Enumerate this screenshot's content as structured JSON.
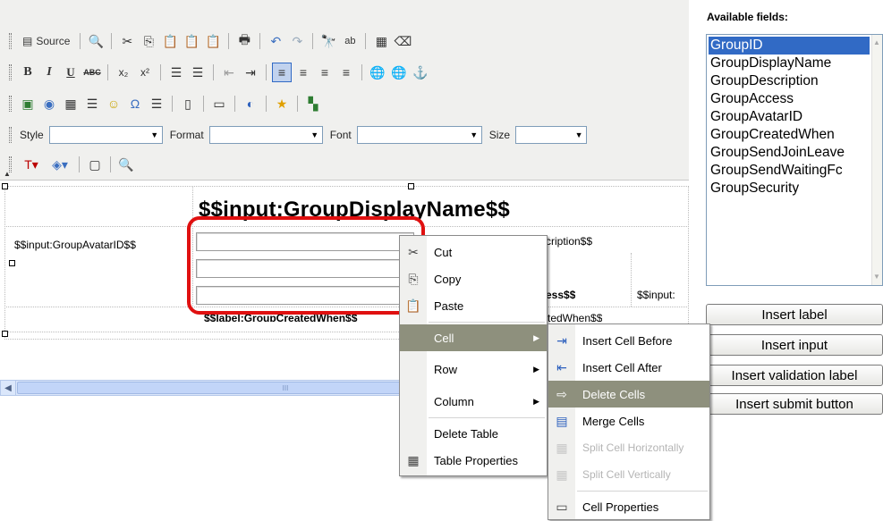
{
  "toolbar": {
    "source_label": "Source",
    "style_label": "Style",
    "format_label": "Format",
    "font_label": "Font",
    "size_label": "Size"
  },
  "design": {
    "title": "$$input:GroupDisplayName$$",
    "avatar_label": "$$input:GroupAvatarID$$",
    "description_partial": "cription$$",
    "access_partial": "ess$$",
    "input_partial": "$$input:",
    "created_label": "$$label:GroupCreatedWhen$$",
    "created_partial": "tedWhen$$",
    "scroll_grip": "III"
  },
  "fields_panel": {
    "title": "Available fields:",
    "items": [
      {
        "label": "GroupID",
        "selected": true
      },
      {
        "label": "GroupDisplayName",
        "selected": false
      },
      {
        "label": "GroupDescription",
        "selected": false
      },
      {
        "label": "GroupAccess",
        "selected": false
      },
      {
        "label": "GroupAvatarID",
        "selected": false
      },
      {
        "label": "GroupCreatedWhen",
        "selected": false
      },
      {
        "label": "GroupSendJoinLeave",
        "selected": false
      },
      {
        "label": "GroupSendWaitingFc",
        "selected": false
      },
      {
        "label": "GroupSecurity",
        "selected": false
      }
    ]
  },
  "buttons": {
    "insert_label": "Insert label",
    "insert_input": "Insert input",
    "insert_validation_label": "Insert validation label",
    "insert_submit_button": "Insert submit button"
  },
  "context_menu": {
    "cut": "Cut",
    "copy": "Copy",
    "paste": "Paste",
    "cell": "Cell",
    "row": "Row",
    "column": "Column",
    "delete_table": "Delete Table",
    "table_properties": "Table Properties"
  },
  "cell_submenu": {
    "insert_cell_before": "Insert Cell Before",
    "insert_cell_after": "Insert Cell After",
    "delete_cells": "Delete Cells",
    "merge_cells": "Merge Cells",
    "split_horizontally": "Split Cell Horizontally",
    "split_vertically": "Split Cell Vertically",
    "cell_properties": "Cell Properties"
  },
  "colors": {
    "selection": "#316ac5",
    "menu_highlight": "#8e907d",
    "callout_red": "#e01010",
    "toolbar_bg": "#f0f0ee"
  }
}
